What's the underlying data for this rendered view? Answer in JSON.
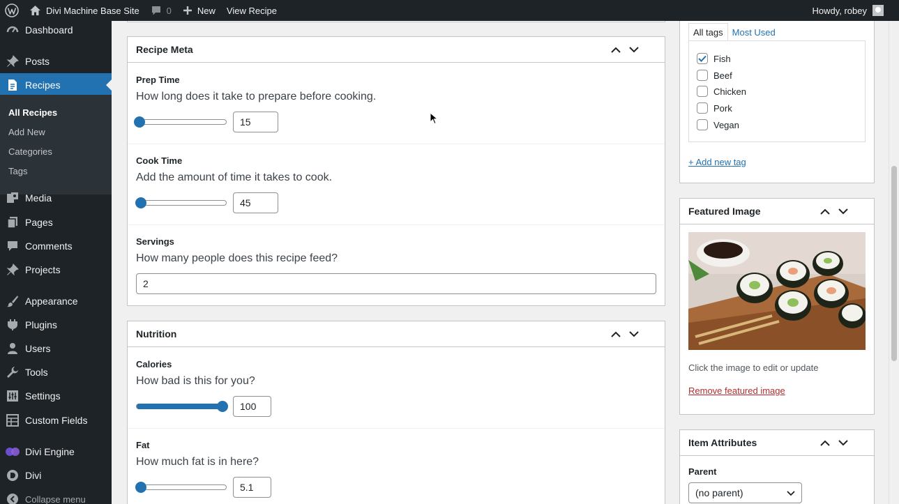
{
  "adminbar": {
    "site_name": "Divi Machine Base Site",
    "comments_count": "0",
    "new_label": "New",
    "view_label": "View Recipe",
    "howdy": "Howdy, robey"
  },
  "sidebar": {
    "items": [
      {
        "label": "Dashboard"
      },
      {
        "label": "Posts"
      },
      {
        "label": "Recipes"
      },
      {
        "label": "Media"
      },
      {
        "label": "Pages"
      },
      {
        "label": "Comments"
      },
      {
        "label": "Projects"
      },
      {
        "label": "Appearance"
      },
      {
        "label": "Plugins"
      },
      {
        "label": "Users"
      },
      {
        "label": "Tools"
      },
      {
        "label": "Settings"
      },
      {
        "label": "Custom Fields"
      },
      {
        "label": "Divi Engine"
      },
      {
        "label": "Divi"
      },
      {
        "label": "Collapse menu"
      }
    ],
    "submenu": [
      {
        "label": "All Recipes"
      },
      {
        "label": "Add New"
      },
      {
        "label": "Categories"
      },
      {
        "label": "Tags"
      }
    ]
  },
  "recipe_meta": {
    "title": "Recipe Meta",
    "prep": {
      "label": "Prep Time",
      "desc": "How long does it take to prepare before cooking.",
      "value": "15",
      "level": 0.03
    },
    "cook": {
      "label": "Cook Time",
      "desc": "Add the amount of time it takes to cook.",
      "value": "45",
      "level": 0.05
    },
    "servings": {
      "label": "Servings",
      "desc": "How many people does this recipe feed?",
      "value": "2"
    }
  },
  "nutrition": {
    "title": "Nutrition",
    "calories": {
      "label": "Calories",
      "desc": "How bad is this for you?",
      "value": "100",
      "level": 0.96
    },
    "fat": {
      "label": "Fat",
      "desc": "How much fat is in here?",
      "value": "5.1",
      "level": 0.05
    }
  },
  "tags_box": {
    "tab_all": "All tags",
    "tab_most": "Most Used",
    "tags": [
      {
        "label": "Fish",
        "checked": true
      },
      {
        "label": "Beef",
        "checked": false
      },
      {
        "label": "Chicken",
        "checked": false
      },
      {
        "label": "Pork",
        "checked": false
      },
      {
        "label": "Vegan",
        "checked": false
      }
    ],
    "add_new": "+ Add new tag"
  },
  "featured_image": {
    "title": "Featured Image",
    "hint": "Click the image to edit or update",
    "remove": "Remove featured image"
  },
  "item_attributes": {
    "title": "Item Attributes",
    "parent_label": "Parent",
    "parent_value": "(no parent)"
  },
  "colors": {
    "admin_bg": "#1d2327",
    "accent": "#2271b1",
    "danger": "#b32d2e"
  }
}
